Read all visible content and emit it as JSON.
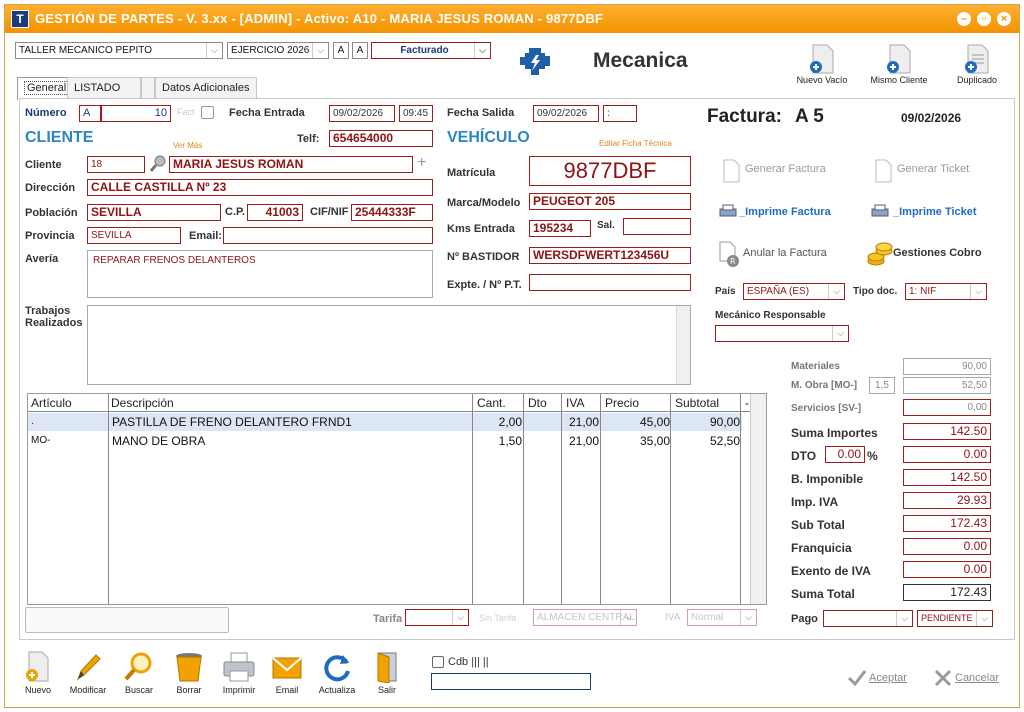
{
  "titlebar": {
    "title": "GESTIÓN DE PARTES - V. 3.xx - [ADMIN] - Activo: A10 - MARIA JESUS ROMAN - 9877DBF",
    "minimize": "–",
    "maximize": "▫",
    "close": "×"
  },
  "header": {
    "workshop": "TALLER MECANICO PEPITO",
    "exercise": "EJERCICIO 2026",
    "font_small": "A",
    "font_large": "A",
    "status": "Facturado",
    "section_title": "Mecanica"
  },
  "toolbar_top": {
    "new_empty": "Nuevo Vacío",
    "same_client": "Mismo Cliente",
    "duplicate": "Duplicado"
  },
  "tabs": [
    "General",
    "LISTADO",
    "",
    "Datos Adicionales"
  ],
  "part": {
    "number_label": "Número",
    "series": "A",
    "number": "10",
    "fact_label": "Fact",
    "entry_label": "Fecha Entrada",
    "entry_date": "09/02/2026",
    "entry_time": "09:45",
    "exit_label": "Fecha Salida",
    "exit_date": "09/02/2026",
    "exit_time": ":"
  },
  "invoice": {
    "label": "Factura:",
    "number": "A 5",
    "date": "09/02/2026"
  },
  "client": {
    "heading": "CLIENTE",
    "see_more": "Ver Más",
    "phone_label": "Telf:",
    "phone": "654654000",
    "client_label": "Cliente",
    "client_id": "18",
    "name": "MARIA JESUS ROMAN",
    "add": "+",
    "address_label": "Dirección",
    "address": "CALLE CASTILLA Nº 23",
    "city_label": "Población",
    "city": "SEVILLA",
    "zip_label": "C.P.",
    "zip": "41003",
    "nif_label": "CIF/NIF",
    "nif": "25444333F",
    "province_label": "Provincia",
    "province": "SEVILLA",
    "email_label": "Email:",
    "email": "",
    "fault_label": "Avería",
    "fault": "REPARAR FRENOS DELANTEROS",
    "works_label_1": "Trabajos",
    "works_label_2": "Realizados",
    "works": ""
  },
  "vehicle": {
    "heading": "VEHÍCULO",
    "edit_link": "Editar Ficha Técnica",
    "plate_label": "Matrícula",
    "plate": "9877DBF",
    "model_label": "Marca/Modelo",
    "model": "PEUGEOT 205",
    "km_label": "Kms Entrada",
    "km": "195234",
    "out_label": "Sal.",
    "km_out": "",
    "frame_label": "Nº BASTIDOR",
    "frame": "WERSDFWERT123456U",
    "file_label": "Expte. / Nº P.T.",
    "file": ""
  },
  "actions": {
    "gen_invoice": "Generar Factura",
    "gen_ticket": "Generar Ticket",
    "print_invoice": "_Imprime Factura",
    "print_ticket": "_Imprime Ticket",
    "cancel_invoice": "Anular la Factura",
    "collections": "Gestiones Cobro"
  },
  "fiscal": {
    "country_label": "País",
    "country": "ESPAÑA (ES)",
    "doc_type_label": "Tipo doc.",
    "doc_type": "1: NIF",
    "mechanic_label": "Mecánico Responsable",
    "mechanic": ""
  },
  "grid": {
    "headers": [
      "Artículo",
      "Descripción",
      "Cant.",
      "Dto",
      "IVA",
      "Precio",
      "Subtotal",
      "-"
    ],
    "rows": [
      {
        "article": ".",
        "description": "PASTILLA DE FRENO DELANTERO FRND1",
        "qty": "2,00",
        "dto": "",
        "iva": "21,00",
        "price": "45,00",
        "subtotal": "90,00"
      },
      {
        "article": "MO-",
        "description": "MANO DE OBRA",
        "qty": "1,50",
        "dto": "",
        "iva": "21,00",
        "price": "35,00",
        "subtotal": "52,50"
      }
    ]
  },
  "footer_fields": {
    "tariff_label": "Tarifa",
    "tariff": "",
    "warehouse_hint": "Sin Tarifa",
    "warehouse": "ALMACEN CENTRAL",
    "iva_label": "IVA",
    "iva": "Normal",
    "payment_label": "Pago",
    "payment": "",
    "payment_status": "PENDIENTE"
  },
  "totals": {
    "materials_label": "Materiales",
    "materials": "90,00",
    "labor_label": "M. Obra [MO-]",
    "labor_hours": "1,5",
    "labor": "52,50",
    "services_label": "Servicios [SV-]",
    "services": "0,00",
    "sum_label": "Suma Importes",
    "sum": "142.50",
    "dto_label": "DTO",
    "dto_pct": "0.00",
    "pct": "%",
    "dto": "0.00",
    "base_label": "B. Imponible",
    "base": "142.50",
    "iva_label": "Imp. IVA",
    "iva": "29.93",
    "subtotal_label": "Sub Total",
    "subtotal": "172.43",
    "franchise_label": "Franquicia",
    "franchise": "0.00",
    "exempt_label": "Exento de IVA",
    "exempt": "0.00",
    "total_label": "Suma Total",
    "total": "172.43"
  },
  "bottom": {
    "new": "Nuevo",
    "modify": "Modificar",
    "search": "Buscar",
    "delete": "Borrar",
    "print": "Imprimir",
    "email": "Email",
    "refresh": "Actualiza",
    "exit": "Salir",
    "cdb_label": "Cdb ||| ||",
    "cdb": "",
    "accept": "Aceptar",
    "cancel": "Cancelar"
  }
}
